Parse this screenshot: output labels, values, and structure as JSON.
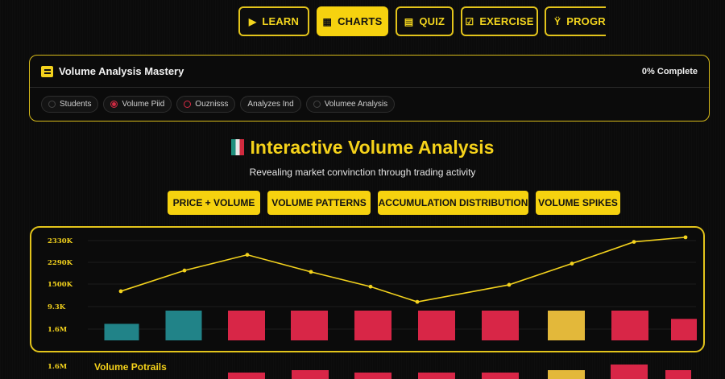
{
  "nav": {
    "tabs": [
      {
        "label": "LEARN",
        "icon": "play-icon",
        "glyph": "▶",
        "active": false
      },
      {
        "label": "CHARTS",
        "icon": "grid-icon",
        "glyph": "▦",
        "active": true
      },
      {
        "label": "QUIZ",
        "icon": "document-icon",
        "glyph": "▤",
        "active": false
      },
      {
        "label": "EXERCISE",
        "icon": "checkbox-icon",
        "glyph": "☑",
        "active": false
      },
      {
        "label": "PROGRESS",
        "icon": "trophy-icon",
        "glyph": "Ÿ",
        "active": false
      }
    ]
  },
  "course": {
    "title": "Volume Analysis Mastery",
    "completion": "0% Complete",
    "chips": [
      {
        "label": "Students",
        "dot": "grey"
      },
      {
        "label": "Volume Piid",
        "dot": "red-filled"
      },
      {
        "label": "Ouznisss",
        "dot": "red"
      },
      {
        "label": "Analyzes Ind",
        "dot": "none"
      },
      {
        "label": "Volumee Analysis",
        "dot": "grey"
      }
    ]
  },
  "hero": {
    "title": "Interactive Volume Analysis",
    "subtitle": "Revealing market convinction through trading activity"
  },
  "modes": [
    "PRICE + VOLUME",
    "VOLUME PATTERNS",
    "ACCUMULATION DISTRIBUTION",
    "VOLUME SPIKES"
  ],
  "colors": {
    "accent": "#f6d20f",
    "teal": "#218388",
    "red": "#d82647",
    "gold": "#e3b83a",
    "line": "#f3d21d"
  },
  "chart_data": {
    "type": "bar",
    "y_tick_labels": [
      "2330K",
      "2290K",
      "1500K",
      "9.3K",
      "1.6M"
    ],
    "line_series": {
      "values": [
        1380,
        1830,
        2170,
        1800,
        1480,
        1150,
        1520,
        1980,
        2450,
        2550
      ]
    },
    "volume_bars": {
      "values": [
        0.5,
        0.9,
        0.9,
        0.9,
        0.9,
        0.9,
        0.9,
        0.9,
        0.9,
        0.65
      ],
      "colors": [
        "teal",
        "teal",
        "red",
        "red",
        "red",
        "red",
        "red",
        "gold",
        "red",
        "red"
      ]
    }
  },
  "below": {
    "title": "Volume Potrails",
    "ytick": "1.6M"
  }
}
